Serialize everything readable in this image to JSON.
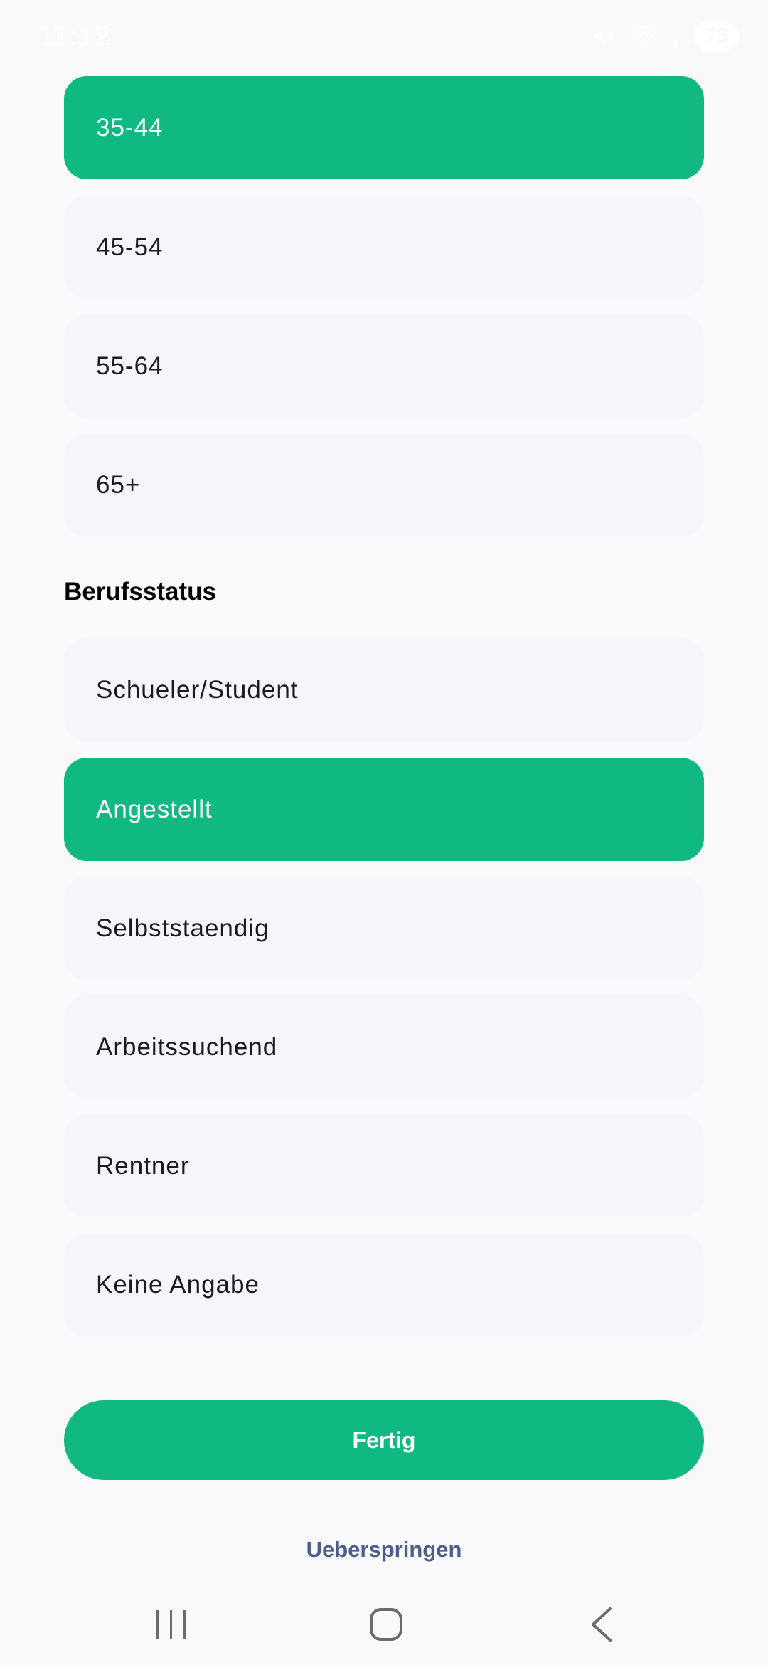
{
  "status_bar": {
    "time": "11:12",
    "battery": "73"
  },
  "age_options": [
    {
      "label": "35-44",
      "selected": true
    },
    {
      "label": "45-54",
      "selected": false
    },
    {
      "label": "55-64",
      "selected": false
    },
    {
      "label": "65+",
      "selected": false
    }
  ],
  "occupation": {
    "title": "Berufsstatus",
    "options": [
      {
        "label": "Schueler/Student",
        "selected": false
      },
      {
        "label": "Angestellt",
        "selected": true
      },
      {
        "label": "Selbststaendig",
        "selected": false
      },
      {
        "label": "Arbeitssuchend",
        "selected": false
      },
      {
        "label": "Rentner",
        "selected": false
      },
      {
        "label": "Keine Angabe",
        "selected": false
      }
    ]
  },
  "actions": {
    "done_label": "Fertig",
    "skip_label": "Ueberspringen"
  },
  "colors": {
    "accent": "#10b981",
    "option_bg": "#f5f5fc",
    "link": "#4b5d8c",
    "background": "#f9f9fb"
  },
  "nav_icons": [
    "recent-apps-icon",
    "home-icon",
    "back-icon"
  ]
}
